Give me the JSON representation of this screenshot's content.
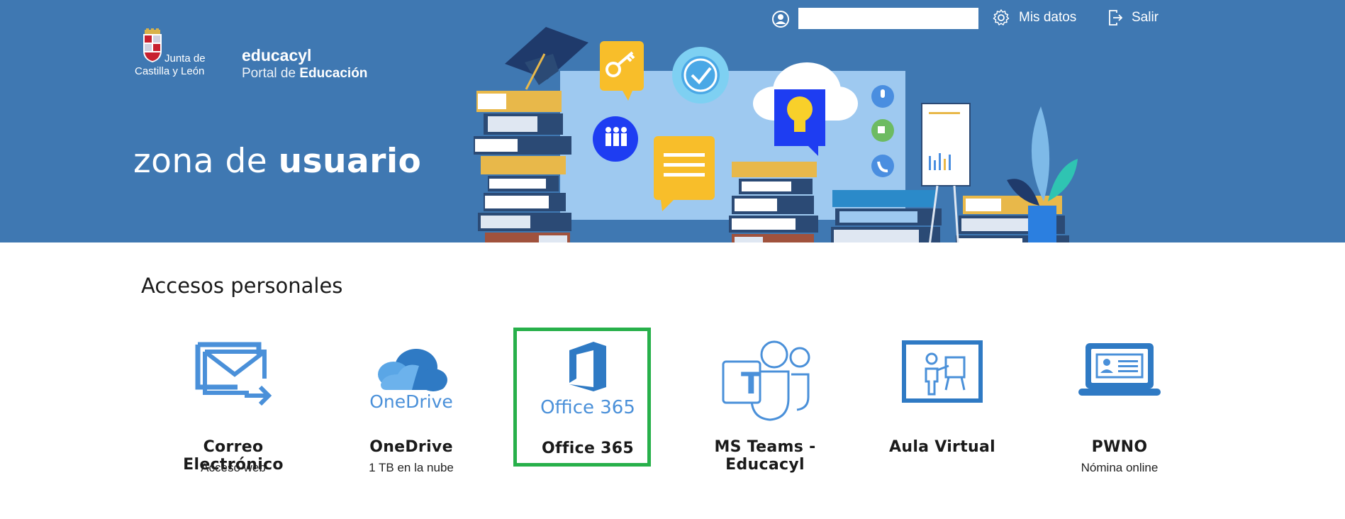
{
  "header": {
    "logo_line1": "Junta de",
    "logo_line2": "Castilla y León",
    "brand": "educacyl",
    "portal_prefix": "Portal de ",
    "portal_bold": "Educación",
    "search_value": "",
    "mis_datos": "Mis datos",
    "salir": "Salir"
  },
  "zona": {
    "light": "zona de ",
    "bold": "usuario"
  },
  "section": {
    "title": "Accesos personales"
  },
  "cards": [
    {
      "title": "Correo Electrónico",
      "subtitle": "Acceso web",
      "icon": "mail-forward-icon"
    },
    {
      "title": "OneDrive",
      "subtitle": "1 TB en la nube",
      "icon": "onedrive-icon",
      "icon_label": "OneDrive"
    },
    {
      "title": "Office 365",
      "subtitle": "",
      "icon": "office365-icon",
      "icon_label": "Office 365",
      "selected": true
    },
    {
      "title": "MS Teams - Educacyl",
      "subtitle": "",
      "icon": "teams-icon",
      "icon_letter": "T"
    },
    {
      "title": "Aula Virtual",
      "subtitle": "",
      "icon": "virtual-classroom-icon"
    },
    {
      "title": "PWNO",
      "subtitle": "Nómina online",
      "icon": "laptop-id-icon"
    }
  ],
  "colors": {
    "banner": "#3f78b2",
    "icon_blue": "#4a90d9",
    "highlight": "#27b04a"
  }
}
